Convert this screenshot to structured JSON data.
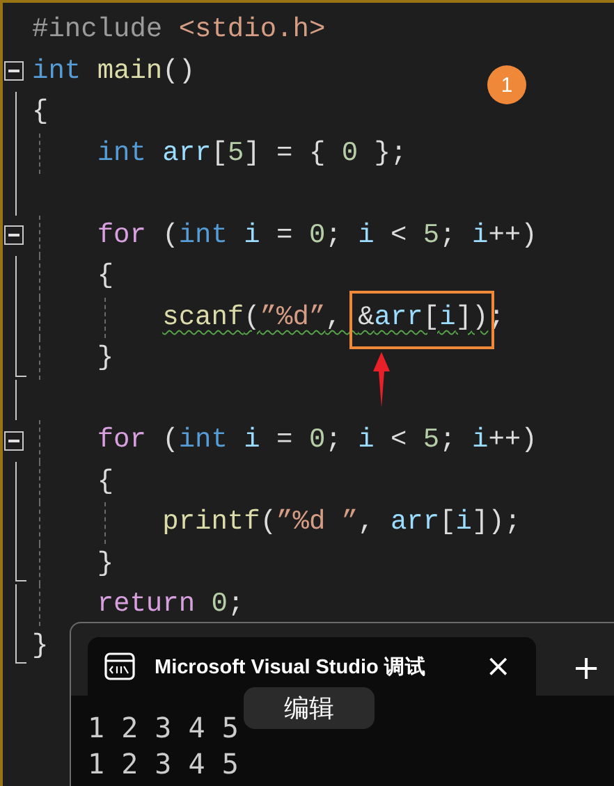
{
  "editor": {
    "lines": [
      {
        "kind": "plain",
        "tokens": [
          {
            "text": "#include ",
            "kind": "pp"
          },
          {
            "text": "<stdio.h>",
            "kind": "inc"
          }
        ]
      },
      {
        "kind": "fold_start",
        "tokens": [
          {
            "text": "int ",
            "kind": "kw"
          },
          {
            "text": "main",
            "kind": "fn"
          },
          {
            "text": "()",
            "kind": "p"
          }
        ]
      },
      {
        "kind": "body",
        "tokens": [
          {
            "text": "{",
            "kind": "p"
          }
        ]
      },
      {
        "kind": "body",
        "tokens": [
          {
            "text": "    int ",
            "kind": "kw"
          },
          {
            "text": "arr",
            "kind": "var"
          },
          {
            "text": "[",
            "kind": "p"
          },
          {
            "text": "5",
            "kind": "num"
          },
          {
            "text": "] = { ",
            "kind": "p"
          },
          {
            "text": "0",
            "kind": "num"
          },
          {
            "text": " };",
            "kind": "p"
          }
        ]
      },
      {
        "kind": "body"
      },
      {
        "kind": "fold_start",
        "tokens": [
          {
            "text": "    for",
            "kind": "ctl"
          },
          {
            "text": " (",
            "kind": "p"
          },
          {
            "text": "int ",
            "kind": "kw"
          },
          {
            "text": "i",
            "kind": "var"
          },
          {
            "text": " = ",
            "kind": "p"
          },
          {
            "text": "0",
            "kind": "num"
          },
          {
            "text": "; ",
            "kind": "p"
          },
          {
            "text": "i",
            "kind": "var"
          },
          {
            "text": " < ",
            "kind": "p"
          },
          {
            "text": "5",
            "kind": "num"
          },
          {
            "text": "; ",
            "kind": "p"
          },
          {
            "text": "i",
            "kind": "var"
          },
          {
            "text": "++)",
            "kind": "p"
          }
        ]
      },
      {
        "kind": "body",
        "tokens": [
          {
            "text": "    {",
            "kind": "p"
          }
        ]
      },
      {
        "kind": "body",
        "warning": true,
        "tokens": [
          {
            "text": "        scanf",
            "kind": "fn"
          },
          {
            "text": "(",
            "kind": "p"
          },
          {
            "text": "”%d”",
            "kind": "str"
          },
          {
            "text": ", ",
            "kind": "p"
          },
          {
            "kind": "box",
            "children": [
              {
                "text": "&",
                "kind": "p"
              },
              {
                "text": "arr",
                "kind": "var"
              },
              {
                "text": "[",
                "kind": "p"
              },
              {
                "text": "i",
                "kind": "var"
              },
              {
                "text": "]",
                "kind": "p"
              },
              {
                "text": ")",
                "kind": "p"
              }
            ]
          },
          {
            "text": ";",
            "kind": "p"
          }
        ]
      },
      {
        "kind": "fold_end",
        "tokens": [
          {
            "text": "    }",
            "kind": "p"
          }
        ]
      },
      {
        "kind": "body"
      },
      {
        "kind": "fold_start",
        "tokens": [
          {
            "text": "    for",
            "kind": "ctl"
          },
          {
            "text": " (",
            "kind": "p"
          },
          {
            "text": "int ",
            "kind": "kw"
          },
          {
            "text": "i",
            "kind": "var"
          },
          {
            "text": " = ",
            "kind": "p"
          },
          {
            "text": "0",
            "kind": "num"
          },
          {
            "text": "; ",
            "kind": "p"
          },
          {
            "text": "i",
            "kind": "var"
          },
          {
            "text": " < ",
            "kind": "p"
          },
          {
            "text": "5",
            "kind": "num"
          },
          {
            "text": "; ",
            "kind": "p"
          },
          {
            "text": "i",
            "kind": "var"
          },
          {
            "text": "++)",
            "kind": "p"
          }
        ]
      },
      {
        "kind": "body",
        "tokens": [
          {
            "text": "    {",
            "kind": "p"
          }
        ]
      },
      {
        "kind": "body",
        "tokens": [
          {
            "text": "        printf",
            "kind": "fn"
          },
          {
            "text": "(",
            "kind": "p"
          },
          {
            "text": "”%d ”",
            "kind": "str"
          },
          {
            "text": ", ",
            "kind": "p"
          },
          {
            "text": "arr",
            "kind": "var"
          },
          {
            "text": "[",
            "kind": "p"
          },
          {
            "text": "i",
            "kind": "var"
          },
          {
            "text": "]);",
            "kind": "p"
          }
        ]
      },
      {
        "kind": "fold_end",
        "tokens": [
          {
            "text": "    }",
            "kind": "p"
          }
        ]
      },
      {
        "kind": "body",
        "tokens": [
          {
            "text": "    return ",
            "kind": "ctl"
          },
          {
            "text": "0",
            "kind": "num"
          },
          {
            "text": ";",
            "kind": "p"
          }
        ]
      },
      {
        "kind": "fold_end",
        "tokens": [
          {
            "text": "}",
            "kind": "p"
          }
        ]
      }
    ]
  },
  "badge": "1",
  "terminal": {
    "tab_title": "Microsoft Visual Studio 调试",
    "close": "×",
    "new_tab": "+",
    "tooltip": "编辑",
    "output": [
      "1 2 3 4 5",
      "1 2 3 4 5"
    ]
  }
}
